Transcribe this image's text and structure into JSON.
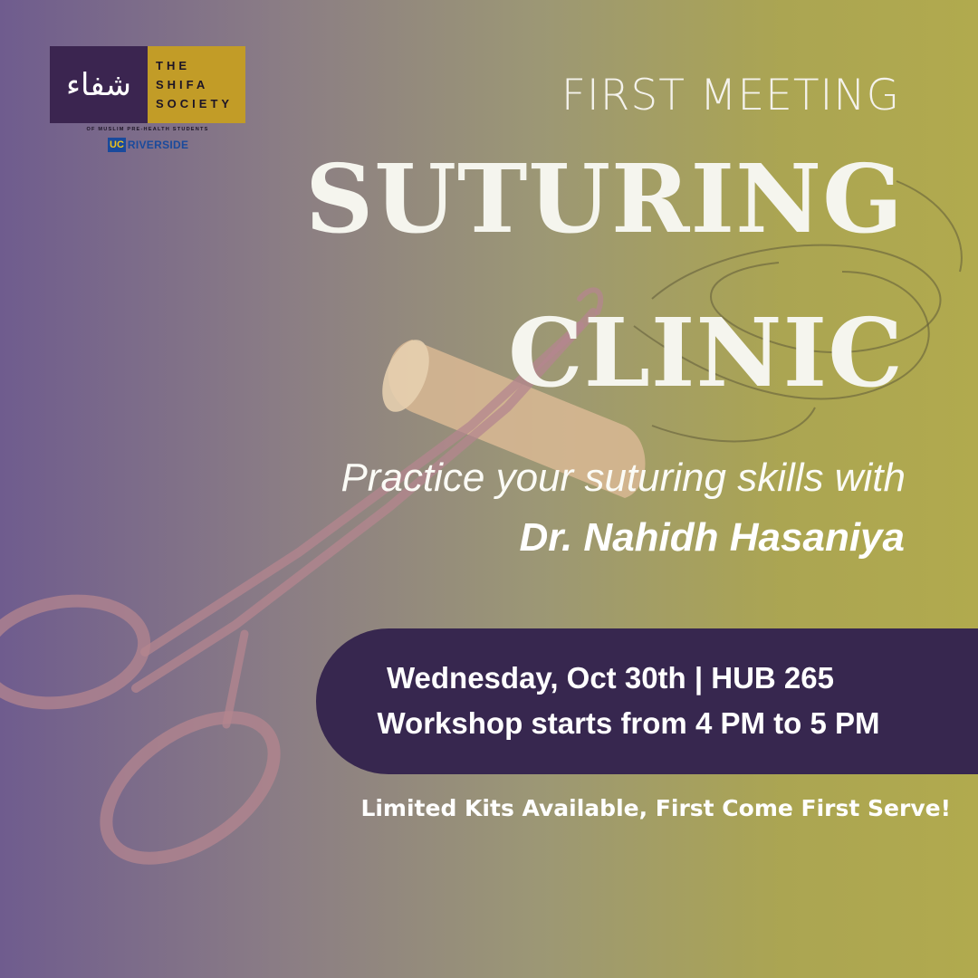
{
  "logo": {
    "arabic": "شفاء",
    "name_lines": [
      "THE",
      "SHIFA",
      "SOCIETY"
    ],
    "subtitle": "OF MUSLIM PRE-HEALTH STUDENTS",
    "university_badge": "UC",
    "university_word": "RIVERSIDE"
  },
  "event": {
    "kicker": "FIRST MEETING",
    "title_line_1": "SUTURING",
    "title_line_2": "CLINIC",
    "tagline": "Practice your suturing skills with",
    "presenter": "Dr. Nahidh Hasaniya",
    "date_location": "Wednesday, Oct 30th | HUB 265",
    "time": "Workshop starts from 4 PM to 5 PM",
    "note": "Limited Kits Available, First Come First Serve!"
  },
  "colors": {
    "plum": "#37274f",
    "gold": "#c29c27",
    "ucr_blue": "#1a4a9c"
  },
  "icons": {
    "photo": "surgical-needle-holder-and-gauze-roll"
  }
}
